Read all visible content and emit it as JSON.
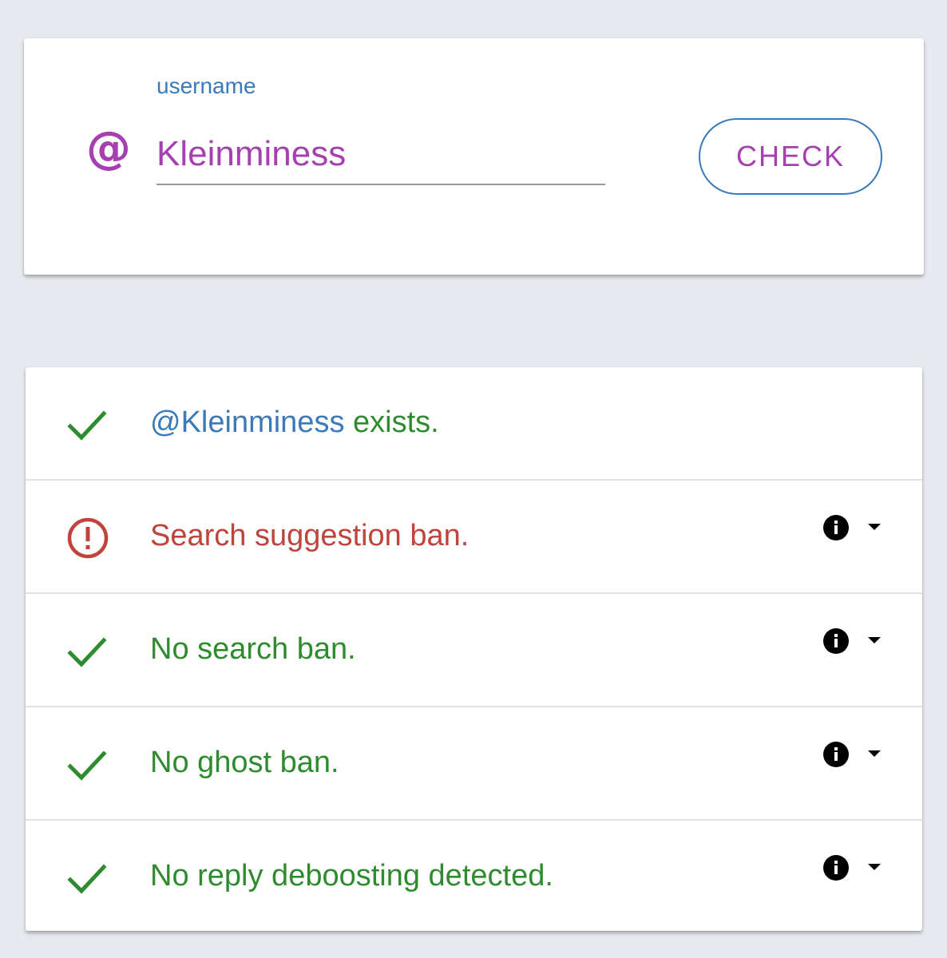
{
  "search": {
    "label": "username",
    "value": "Kleinminess",
    "at_symbol": "@",
    "button_label": "CHECK",
    "accent_color": "#a63fb0",
    "label_color": "#3a7ab8"
  },
  "results": {
    "exists": {
      "handle": "@Kleinminess",
      "text": " exists.",
      "status": "ok",
      "icon": "check-icon"
    },
    "items": [
      {
        "text": "Search suggestion ban.",
        "status": "bad",
        "icon": "alert-circle-icon"
      },
      {
        "text": "No search ban.",
        "status": "ok",
        "icon": "check-icon"
      },
      {
        "text": "No ghost ban.",
        "status": "ok",
        "icon": "check-icon"
      },
      {
        "text": "No reply deboosting detected.",
        "status": "ok",
        "icon": "check-icon"
      }
    ],
    "colors": {
      "ok": "#2e8b2e",
      "bad": "#c0433c",
      "handle": "#3a7ab8"
    }
  }
}
